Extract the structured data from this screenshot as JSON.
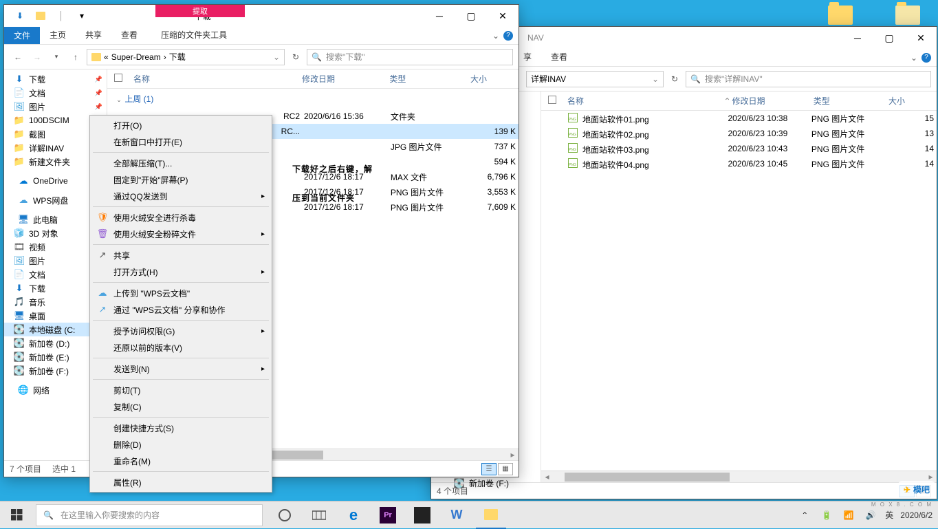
{
  "desktop": {
    "icon1": "",
    "icon2": ""
  },
  "window_front": {
    "title": "下载",
    "context_tab_title": "提取",
    "qa_icons": [
      "down-arrow-icon",
      "folder-icon",
      "divider-icon"
    ],
    "ribbon": {
      "file": "文件",
      "tabs": [
        "主页",
        "共享",
        "查看"
      ],
      "context_tab": "压缩的文件夹工具"
    },
    "nav": {
      "back": "←",
      "fwd": "→",
      "up": "↑",
      "address_parts": [
        "«",
        "Super-Dream",
        "›",
        "下载"
      ],
      "refresh": "↻",
      "search_placeholder": "搜索\"下载\""
    },
    "tree": [
      {
        "icon": "⬇",
        "color": "#1979ca",
        "label": "下载",
        "level": 1,
        "pinned": true
      },
      {
        "icon": "📄",
        "color": "#555",
        "label": "文档",
        "level": 1,
        "pinned": true
      },
      {
        "icon": "🖼",
        "color": "#3aa0d8",
        "label": "图片",
        "level": 1,
        "pinned": true
      },
      {
        "icon": "📁",
        "color": "#ffd86b",
        "label": "100DSCIM",
        "level": 1
      },
      {
        "icon": "📁",
        "color": "#ffd86b",
        "label": "截图",
        "level": 1
      },
      {
        "icon": "📁",
        "color": "#ffd86b",
        "label": "详解INAV",
        "level": 1
      },
      {
        "icon": "📁",
        "color": "#ffd86b",
        "label": "新建文件夹",
        "level": 1
      },
      {
        "gap": true
      },
      {
        "icon": "☁",
        "color": "#0078d4",
        "label": "OneDrive",
        "level": 0
      },
      {
        "gap": true
      },
      {
        "icon": "☁",
        "color": "#4aa3df",
        "label": "WPS网盘",
        "level": 0
      },
      {
        "gap": true
      },
      {
        "icon": "🖥",
        "color": "#1979ca",
        "label": "此电脑",
        "level": 0
      },
      {
        "icon": "🧊",
        "color": "#5dd",
        "label": "3D 对象",
        "level": 1
      },
      {
        "icon": "🎞",
        "color": "#555",
        "label": "视频",
        "level": 1
      },
      {
        "icon": "🖼",
        "color": "#3aa0d8",
        "label": "图片",
        "level": 1
      },
      {
        "icon": "📄",
        "color": "#555",
        "label": "文档",
        "level": 1
      },
      {
        "icon": "⬇",
        "color": "#1979ca",
        "label": "下载",
        "level": 1
      },
      {
        "icon": "🎵",
        "color": "#2a7ab0",
        "label": "音乐",
        "level": 1
      },
      {
        "icon": "🖥",
        "color": "#1979ca",
        "label": "桌面",
        "level": 1
      },
      {
        "icon": "💽",
        "color": "#888",
        "label": "本地磁盘 (C:",
        "level": 1,
        "sel": true
      },
      {
        "icon": "💽",
        "color": "#888",
        "label": "新加卷 (D:)",
        "level": 1
      },
      {
        "icon": "💽",
        "color": "#888",
        "label": "新加卷 (E:)",
        "level": 1
      },
      {
        "icon": "💽",
        "color": "#888",
        "label": "新加卷 (F:)",
        "level": 1
      },
      {
        "gap": true
      },
      {
        "icon": "🌐",
        "color": "#1979ca",
        "label": "网络",
        "level": 0
      }
    ],
    "columns": {
      "name": "名称",
      "date": "修改日期",
      "type": "类型",
      "size": "大小"
    },
    "group_label": "上周 (1)",
    "rows_vis": [
      {
        "name_suffix": "RC2",
        "date": "2020/6/16 15:36",
        "type": "文件夹",
        "size": ""
      },
      {
        "name_suffix": "RC...",
        "date": "",
        "type": "",
        "size": "139 K",
        "sel": true
      },
      {
        "name_suffix": "",
        "date": "",
        "type": "JPG 图片文件",
        "size": "737 K"
      },
      {
        "name_suffix": "",
        "date": "",
        "type": "",
        "size": "594 K"
      },
      {
        "name_suffix": "",
        "date": "2017/12/6 18:17",
        "type": "MAX 文件",
        "size": "6,796 K"
      },
      {
        "name_suffix": "",
        "date": "2017/12/6 18:17",
        "type": "PNG 图片文件",
        "size": "3,553 K"
      },
      {
        "name_suffix": "",
        "date": "2017/12/6 18:17",
        "type": "PNG 图片文件",
        "size": "7,609 K"
      }
    ],
    "status": {
      "count": "7 个项目",
      "selected": "选中 1"
    }
  },
  "context_menu": [
    {
      "label": "打开(O)"
    },
    {
      "label": "在新窗口中打开(E)"
    },
    {
      "sep": true
    },
    {
      "label": "全部解压缩(T)..."
    },
    {
      "label": "固定到\"开始\"屏幕(P)"
    },
    {
      "label": "通过QQ发送到",
      "sub": true
    },
    {
      "sep": true
    },
    {
      "label": "使用火绒安全进行杀毒",
      "icon": "🛡",
      "iconColor": "#ff7a00"
    },
    {
      "label": "使用火绒安全粉碎文件",
      "icon": "🗑",
      "iconColor": "#9561d4",
      "sub": true
    },
    {
      "sep": true
    },
    {
      "label": "共享",
      "icon": "↗",
      "iconColor": "#555"
    },
    {
      "label": "打开方式(H)",
      "sub": true
    },
    {
      "sep": true
    },
    {
      "label": "上传到 \"WPS云文档\"",
      "icon": "☁",
      "iconColor": "#4aa3df"
    },
    {
      "label": "通过 \"WPS云文档\" 分享和协作",
      "icon": "↗",
      "iconColor": "#4aa3df"
    },
    {
      "sep": true
    },
    {
      "label": "授予访问权限(G)",
      "sub": true
    },
    {
      "label": "还原以前的版本(V)"
    },
    {
      "sep": true
    },
    {
      "label": "发送到(N)",
      "sub": true
    },
    {
      "sep": true
    },
    {
      "label": "剪切(T)"
    },
    {
      "label": "复制(C)"
    },
    {
      "sep": true
    },
    {
      "label": "创建快捷方式(S)"
    },
    {
      "label": "删除(D)"
    },
    {
      "label": "重命名(M)"
    },
    {
      "sep": true
    },
    {
      "label": "属性(R)"
    }
  ],
  "overlay": {
    "line1": "下载好之后右键，解",
    "line2": "压到当前文件夹"
  },
  "window_back": {
    "title": "NAV",
    "ribbon_visible_tabs": [
      "享",
      "查看"
    ],
    "address": "详解INAV",
    "search_placeholder": "搜索\"详解INAV\"",
    "columns": {
      "name": "名称",
      "date": "修改日期",
      "type": "类型",
      "size": "大小"
    },
    "rows": [
      {
        "name": "地面站软件01.png",
        "date": "2020/6/23 10:38",
        "type": "PNG 图片文件",
        "size": "15"
      },
      {
        "name": "地面站软件02.png",
        "date": "2020/6/23 10:39",
        "type": "PNG 图片文件",
        "size": "13"
      },
      {
        "name": "地面站软件03.png",
        "date": "2020/6/23 10:43",
        "type": "PNG 图片文件",
        "size": "14"
      },
      {
        "name": "地面站软件04.png",
        "date": "2020/6/23 10:45",
        "type": "PNG 图片文件",
        "size": "14"
      }
    ],
    "status": {
      "count": "4 个项目"
    }
  },
  "back_tree_visible": {
    "label": "新加卷 (F:)"
  },
  "taskbar": {
    "search_placeholder": "在这里输入你要搜索的内容",
    "tray": {
      "ime": "英",
      "date_short": "2020/6/2"
    },
    "icons": [
      "cortana-icon",
      "taskview-icon",
      "edge-icon",
      "premiere-icon",
      "app-icon",
      "wps-icon",
      "explorer-icon"
    ]
  },
  "watermark": {
    "text": "模吧",
    "url": "M O X 8 . C O M"
  }
}
